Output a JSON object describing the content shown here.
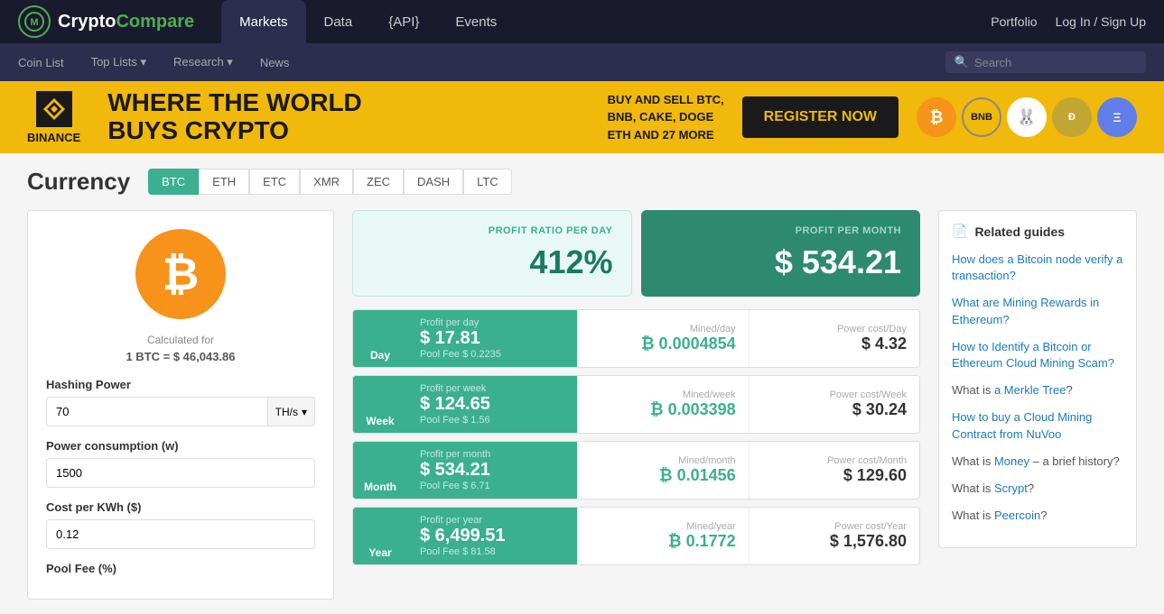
{
  "logo": {
    "text_dark": "Crypto",
    "text_green": "Compare"
  },
  "top_nav": {
    "items": [
      {
        "label": "Markets",
        "active": true
      },
      {
        "label": "Data",
        "active": false
      },
      {
        "label": "{API}",
        "active": false
      },
      {
        "label": "Events",
        "active": false
      }
    ],
    "right": {
      "portfolio": "Portfolio",
      "login": "Log In / Sign Up"
    }
  },
  "second_nav": {
    "items": [
      {
        "label": "Coin List"
      },
      {
        "label": "Top Lists ▾"
      },
      {
        "label": "Research ▾"
      },
      {
        "label": "News"
      }
    ],
    "search_placeholder": "Search"
  },
  "banner": {
    "logo_text": "BINANCE",
    "headline_line1": "WHERE THE WORLD",
    "headline_line2": "BUYS CRYPTO",
    "sub_text": "BUY AND SELL BTC,\nBNB, CAKE, DOGE\nETH AND 27 MORE",
    "cta": "REGISTER NOW"
  },
  "currency": {
    "title": "Currency",
    "tabs": [
      "BTC",
      "ETH",
      "ETC",
      "XMR",
      "ZEC",
      "DASH",
      "LTC"
    ],
    "active_tab": "BTC"
  },
  "calc": {
    "btc_symbol": "₿",
    "calc_for": "Calculated for",
    "rate": "1 BTC = $ 46,043.86",
    "hashing_power_label": "Hashing Power",
    "hashing_power_value": "70",
    "hashing_power_unit": "TH/s",
    "power_consumption_label": "Power consumption (w)",
    "power_consumption_value": "1500",
    "cost_per_kwh_label": "Cost per KWh ($)",
    "cost_per_kwh_value": "0.12",
    "pool_fee_label": "Pool Fee (%)"
  },
  "profit_ratio": {
    "label": "PROFIT RATIO PER DAY",
    "value": "412%"
  },
  "profit_month": {
    "label": "PROFIT PER MONTH",
    "value": "$ 534.21"
  },
  "rows": [
    {
      "period": "Day",
      "profit_label": "Profit per day",
      "profit_value": "$ 17.81",
      "pool_fee": "Pool Fee $ 0.2235",
      "mined_label": "Mined/day",
      "mined_value": "₿ 0.0004854",
      "power_label": "Power cost/Day",
      "power_value": "$ 4.32"
    },
    {
      "period": "Week",
      "profit_label": "Profit per week",
      "profit_value": "$ 124.65",
      "pool_fee": "Pool Fee $ 1.56",
      "mined_label": "Mined/week",
      "mined_value": "₿ 0.003398",
      "power_label": "Power cost/Week",
      "power_value": "$ 30.24"
    },
    {
      "period": "Month",
      "profit_label": "Profit per month",
      "profit_value": "$ 534.21",
      "pool_fee": "Pool Fee $ 6.71",
      "mined_label": "Mined/month",
      "mined_value": "₿ 0.01456",
      "power_label": "Power cost/Month",
      "power_value": "$ 129.60"
    },
    {
      "period": "Year",
      "profit_label": "Profit per year",
      "profit_value": "$ 6,499.51",
      "pool_fee": "Pool Fee $ 81.58",
      "mined_label": "Mined/year",
      "mined_value": "₿ 0.1772",
      "power_label": "Power cost/Year",
      "power_value": "$ 1,576.80"
    }
  ],
  "related_guides": {
    "title": "Related guides",
    "guides": [
      {
        "type": "link",
        "text": "How does a Bitcoin node verify a transaction?"
      },
      {
        "type": "link",
        "text": "What are Mining Rewards in Ethereum?"
      },
      {
        "type": "link",
        "text": "How to Identify a Bitcoin or Ethereum Cloud Mining Scam?"
      },
      {
        "type": "mixed",
        "parts": [
          "What is ",
          "a Merkle Tree",
          "?"
        ]
      },
      {
        "type": "link",
        "text": "How to buy a Cloud Mining Contract from NuVoo"
      },
      {
        "type": "mixed",
        "parts": [
          "What is ",
          "Money",
          " – a brief history?"
        ]
      },
      {
        "type": "mixed",
        "parts": [
          "What is ",
          "Scrypt",
          "?"
        ]
      },
      {
        "type": "mixed",
        "parts": [
          "What is ",
          "Peercoin",
          "?"
        ]
      }
    ]
  }
}
